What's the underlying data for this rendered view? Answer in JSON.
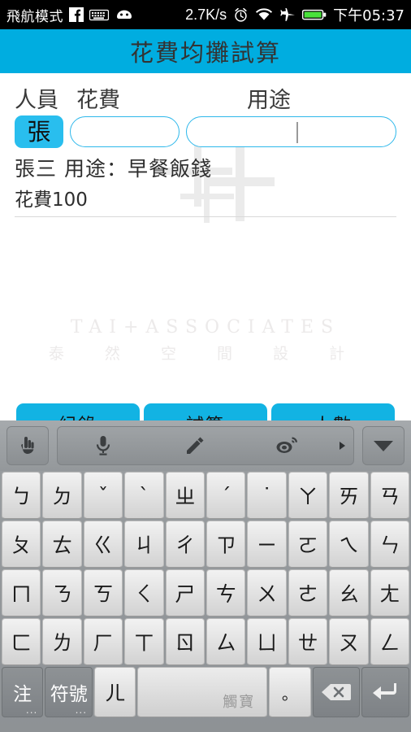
{
  "statusbar": {
    "mode_label": "飛航模式",
    "icons_left": [
      "facebook-icon",
      "keyboard-icon",
      "android-robot-icon"
    ],
    "network_speed": "2.7K/s",
    "icons_right": [
      "alarm-icon",
      "wifi-icon",
      "airplane-icon",
      "battery-icon"
    ],
    "time": "下午05:37"
  },
  "app": {
    "title": "花費均攤試算",
    "accent_color": "#00ADE0"
  },
  "form": {
    "label_person": "人員",
    "label_cost": "花費",
    "label_use": "用途",
    "person_chip": "張",
    "cost_value": "",
    "cost_placeholder": "",
    "use_value": "",
    "use_placeholder": ""
  },
  "result": {
    "line1": "張三 用途：早餐飯錢",
    "line2": "花費100"
  },
  "watermark": {
    "english": "TAI+ASSOCIATES",
    "chinese": "泰 然 空 間 設 計"
  },
  "buttons": [
    {
      "label": "紀錄",
      "name": "record-button"
    },
    {
      "label": "試算",
      "name": "calculate-button"
    },
    {
      "label": "人數",
      "name": "people-count-button"
    }
  ],
  "keyboard": {
    "toolbar": {
      "handwriting_icon": "hand-pointer-icon",
      "mic_icon": "microphone-icon",
      "pen_icon": "pencil-icon",
      "weibo_icon": "weibo-eye-icon",
      "more_icon": "triangle-right-icon",
      "collapse_icon": "chevron-down-icon"
    },
    "row1": [
      "ㄅ",
      "ㄉ",
      "ˇ",
      "ˋ",
      "ㄓ",
      "ˊ",
      "˙",
      "ㄚ",
      "ㄞ",
      "ㄢ"
    ],
    "row2": [
      "ㄆ",
      "ㄊ",
      "ㄍ",
      "ㄐ",
      "ㄔ",
      "ㄗ",
      "ㄧ",
      "ㄛ",
      "ㄟ",
      "ㄣ"
    ],
    "row3": [
      "ㄇ",
      "ㄋ",
      "ㄎ",
      "ㄑ",
      "ㄕ",
      "ㄘ",
      "ㄨ",
      "ㄜ",
      "ㄠ",
      "ㄤ"
    ],
    "row4": [
      "ㄈ",
      "ㄌ",
      "ㄏ",
      "ㄒ",
      "ㄖ",
      "ㄙ",
      "ㄩ",
      "ㄝ",
      "ㄡ",
      "ㄥ"
    ],
    "bottom": {
      "mode_key": "注",
      "symbol_key": "符號",
      "er_key": "ㄦ",
      "space_brand": "觸寶",
      "period_key": "。",
      "backspace_icon": "backspace-icon",
      "enter_icon": "enter-return-icon",
      "dots": "..."
    }
  }
}
